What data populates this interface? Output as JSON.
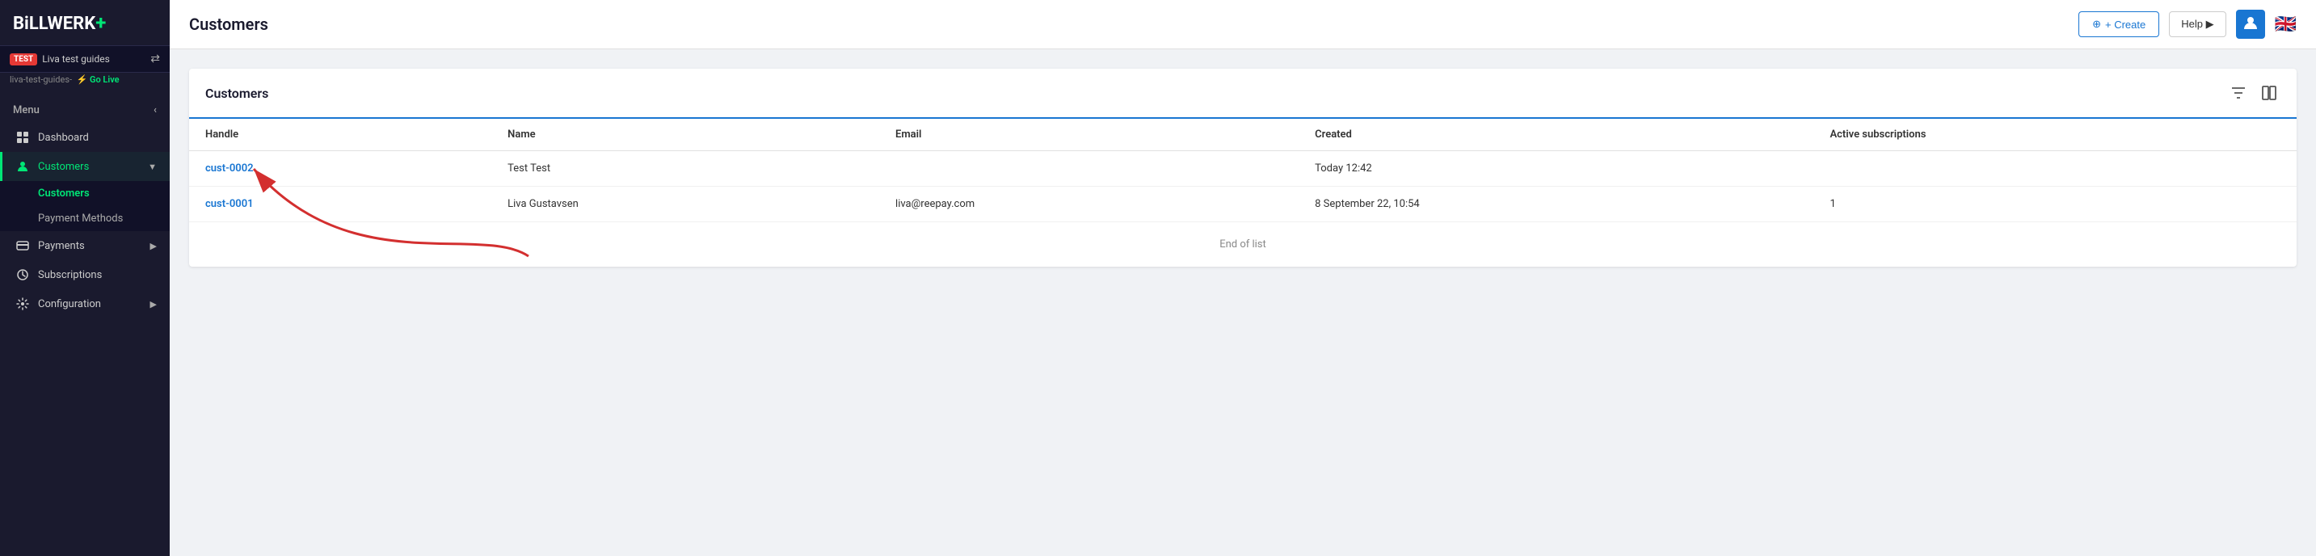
{
  "logo": {
    "text": "BiLLWERK",
    "plus": "+"
  },
  "env": {
    "badge": "TEST",
    "name": "Liva test guides",
    "slug": "liva-test-guides-",
    "go_live_label": "⚡ Go Live",
    "swap_icon": "⇄"
  },
  "menu_label": "Menu",
  "nav": {
    "dashboard": "Dashboard",
    "customers": "Customers",
    "customers_sub_customers": "Customers",
    "customers_sub_payment_methods": "Payment Methods",
    "payments": "Payments",
    "subscriptions": "Subscriptions",
    "configuration": "Configuration"
  },
  "header": {
    "page_title": "Customers",
    "create_label": "+ Create",
    "help_label": "Help ▶",
    "avatar_icon": "👤",
    "flag": "🇬🇧"
  },
  "customers_section": {
    "title": "Customers",
    "filter_icon": "filter",
    "columns_icon": "columns",
    "columns": [
      {
        "key": "handle",
        "label": "Handle"
      },
      {
        "key": "name",
        "label": "Name"
      },
      {
        "key": "email",
        "label": "Email"
      },
      {
        "key": "created",
        "label": "Created"
      },
      {
        "key": "active_subscriptions",
        "label": "Active subscriptions"
      }
    ],
    "rows": [
      {
        "handle": "cust-0002",
        "name": "Test Test",
        "email": "",
        "created": "Today 12:42",
        "active_subscriptions": ""
      },
      {
        "handle": "cust-0001",
        "name": "Liva Gustavsen",
        "email": "liva@reepay.com",
        "created": "8 September 22, 10:54",
        "active_subscriptions": "1"
      }
    ],
    "end_of_list": "End of list"
  }
}
